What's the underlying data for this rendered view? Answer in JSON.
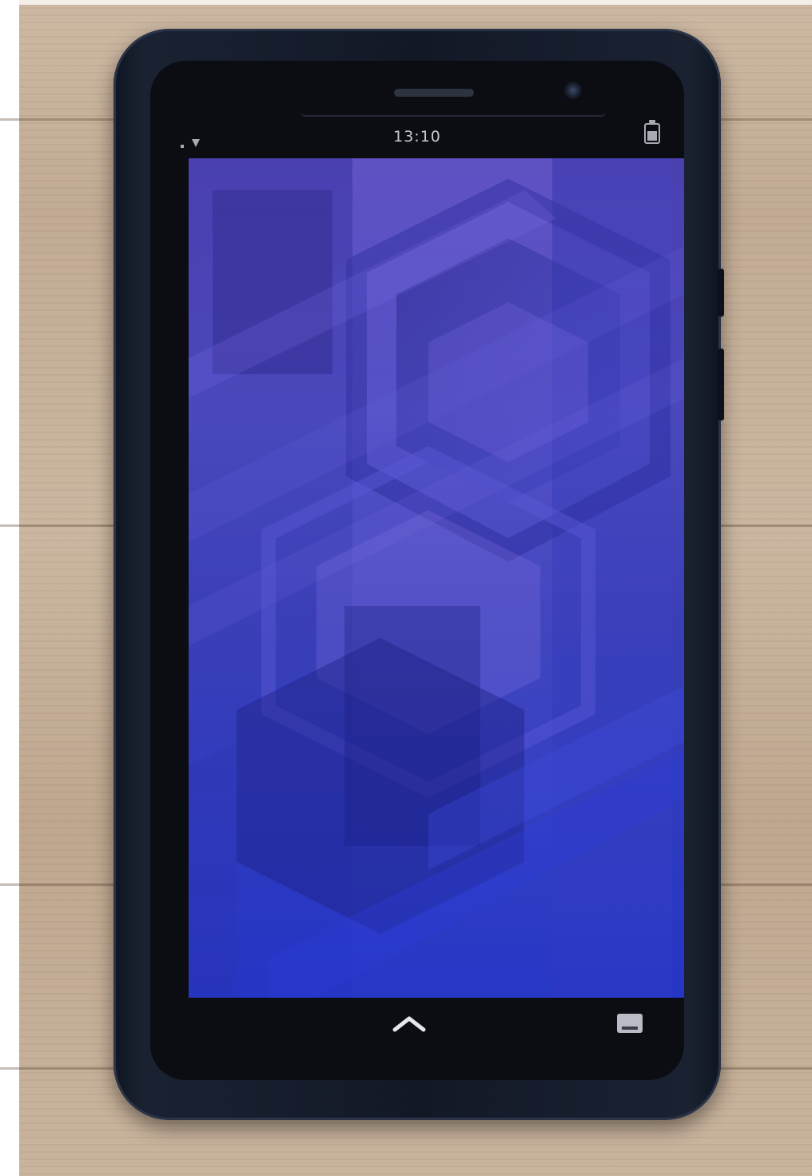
{
  "status_bar": {
    "time": "13:10",
    "signal_icon": "signal-icon",
    "battery_icon": "battery-icon"
  },
  "wallpaper": {
    "style": "abstract-hexagon-blue-purple",
    "colors": {
      "top": "#4a3fb0",
      "middle": "#5050c8",
      "bottom": "#2238d8"
    }
  },
  "navigation": {
    "up_icon": "chevron-up-icon",
    "keyboard_icon": "keyboard-icon"
  }
}
